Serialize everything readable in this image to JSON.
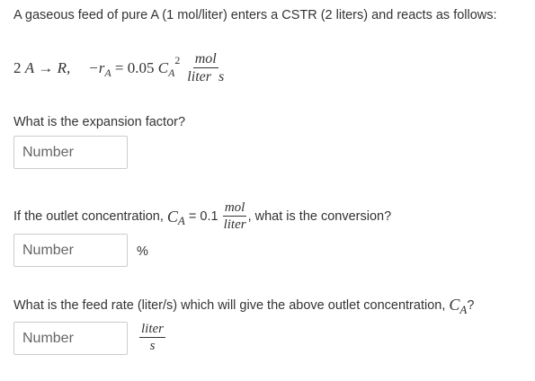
{
  "intro": "A gaseous feed of pure A (1 mol/liter) enters a CSTR (2 liters) and reacts as follows:",
  "reaction": {
    "coef": "2",
    "reactant": "A",
    "arrow": "→",
    "product": "R,",
    "rate_lhs": "−r",
    "rate_sub": "A",
    "equals": "= 0.05",
    "conc": "C",
    "conc_sub": "A",
    "conc_sup": "2",
    "unit_num": "mol",
    "unit_den": "liter  s"
  },
  "q1": {
    "prompt": "What is the expansion factor?",
    "placeholder": "Number"
  },
  "q2": {
    "prompt_before": "If the outlet concentration,",
    "var": "C",
    "var_sub": "A",
    "equals": "= 0.1",
    "unit_num": "mol",
    "unit_den": "liter",
    "prompt_after": ", what is the conversion?",
    "placeholder": "Number",
    "unit": "%"
  },
  "q3": {
    "prompt_before": "What is the feed rate (liter/s) which will give the above outlet concentration,",
    "var": "C",
    "var_sub": "A",
    "prompt_after": "?",
    "placeholder": "Number",
    "unit_num": "liter",
    "unit_den": "s"
  }
}
